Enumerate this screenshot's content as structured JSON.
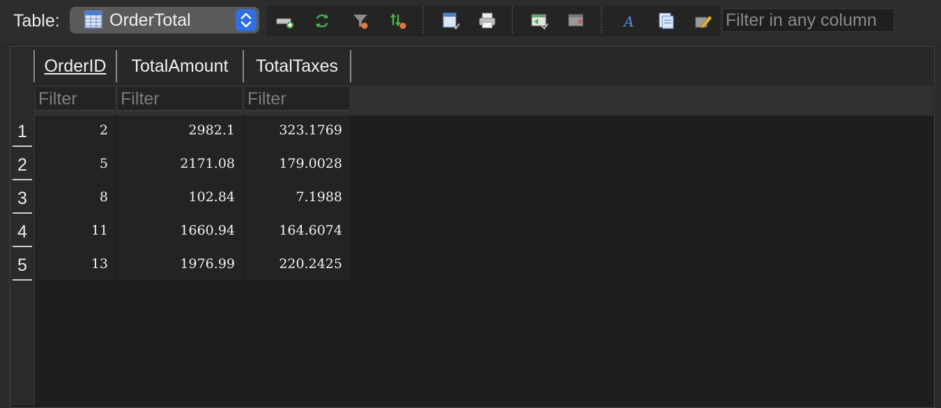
{
  "toolbar": {
    "table_label": "Table:",
    "selected_table": "OrderTotal",
    "icons": [
      "add-record-icon",
      "refresh-icon",
      "filter-icon",
      "sort-icon",
      "save-table-icon",
      "print-icon",
      "import-icon",
      "export-icon",
      "font-icon",
      "copy-icon",
      "edit-icon"
    ],
    "filter_any_placeholder": "Filter in any column"
  },
  "table": {
    "columns": [
      {
        "name": "OrderID",
        "filter_placeholder": "Filter"
      },
      {
        "name": "TotalAmount",
        "filter_placeholder": "Filter"
      },
      {
        "name": "TotalTaxes",
        "filter_placeholder": "Filter"
      }
    ],
    "rows": [
      {
        "num": "1",
        "cells": [
          "2",
          "2982.1",
          "323.1769"
        ]
      },
      {
        "num": "2",
        "cells": [
          "5",
          "2171.08",
          "179.0028"
        ]
      },
      {
        "num": "3",
        "cells": [
          "8",
          "102.84",
          "7.1988"
        ]
      },
      {
        "num": "4",
        "cells": [
          "11",
          "1660.94",
          "164.6074"
        ]
      },
      {
        "num": "5",
        "cells": [
          "13",
          "1976.99",
          "220.2425"
        ]
      }
    ]
  },
  "colors": {
    "background": "#2b2b2b",
    "grid_background": "#1e1e1e",
    "accent": "#2f6fe0"
  }
}
